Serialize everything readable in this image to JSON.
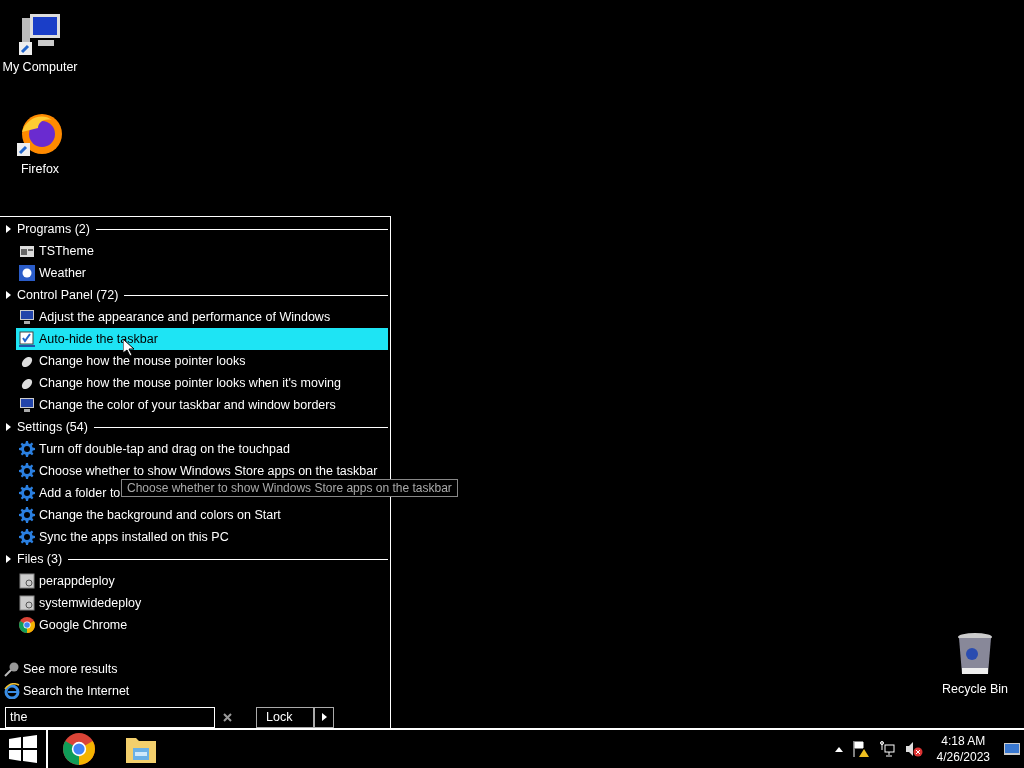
{
  "desktop_icons": [
    {
      "label": "My Computer",
      "kind": "computer"
    },
    {
      "label": "Firefox",
      "kind": "firefox"
    },
    {
      "label": "Recycle Bin",
      "kind": "bin"
    }
  ],
  "start_menu": {
    "groups": [
      {
        "title": "Programs (2)",
        "items": [
          {
            "label": "TSTheme",
            "kind": "window",
            "selected": false
          },
          {
            "label": "Weather",
            "kind": "sun",
            "selected": false
          }
        ]
      },
      {
        "title": "Control Panel (72)",
        "items": [
          {
            "label": "Adjust the appearance and performance of Windows",
            "kind": "display",
            "selected": false
          },
          {
            "label": "Auto-hide the taskbar",
            "kind": "check",
            "selected": true
          },
          {
            "label": "Change how the mouse pointer looks",
            "kind": "mouse",
            "selected": false
          },
          {
            "label": "Change how the mouse pointer looks when it's moving",
            "kind": "mouse",
            "selected": false
          },
          {
            "label": "Change the color of your taskbar and window borders",
            "kind": "display",
            "selected": false
          }
        ]
      },
      {
        "title": "Settings (54)",
        "items": [
          {
            "label": "Turn off double-tap and drag on the touchpad",
            "kind": "gear",
            "selected": false
          },
          {
            "label": "Choose whether to show Windows Store apps on the taskbar",
            "kind": "gear",
            "selected": false
          },
          {
            "label": "Add a folder to",
            "kind": "gear",
            "selected": false
          },
          {
            "label": "Change the background and colors on Start",
            "kind": "gear",
            "selected": false
          },
          {
            "label": "Sync the apps installed on this PC",
            "kind": "gear",
            "selected": false
          }
        ]
      },
      {
        "title": "Files (3)",
        "items": [
          {
            "label": "perappdeploy",
            "kind": "file",
            "selected": false
          },
          {
            "label": "systemwidedeploy",
            "kind": "file",
            "selected": false
          },
          {
            "label": "Google Chrome",
            "kind": "chrome",
            "selected": false
          }
        ]
      }
    ],
    "tooltip": "Choose whether to show Windows Store apps on the taskbar",
    "links": [
      {
        "label": "See more results",
        "kind": "search"
      },
      {
        "label": "Search the Internet",
        "kind": "ie"
      }
    ],
    "search": {
      "value": "the"
    },
    "power_button": "Lock"
  },
  "taskbar": {
    "pinned": [
      {
        "kind": "chrome"
      },
      {
        "kind": "explorer"
      }
    ],
    "clock": {
      "time": "4:18 AM",
      "date": "4/26/2023"
    }
  }
}
